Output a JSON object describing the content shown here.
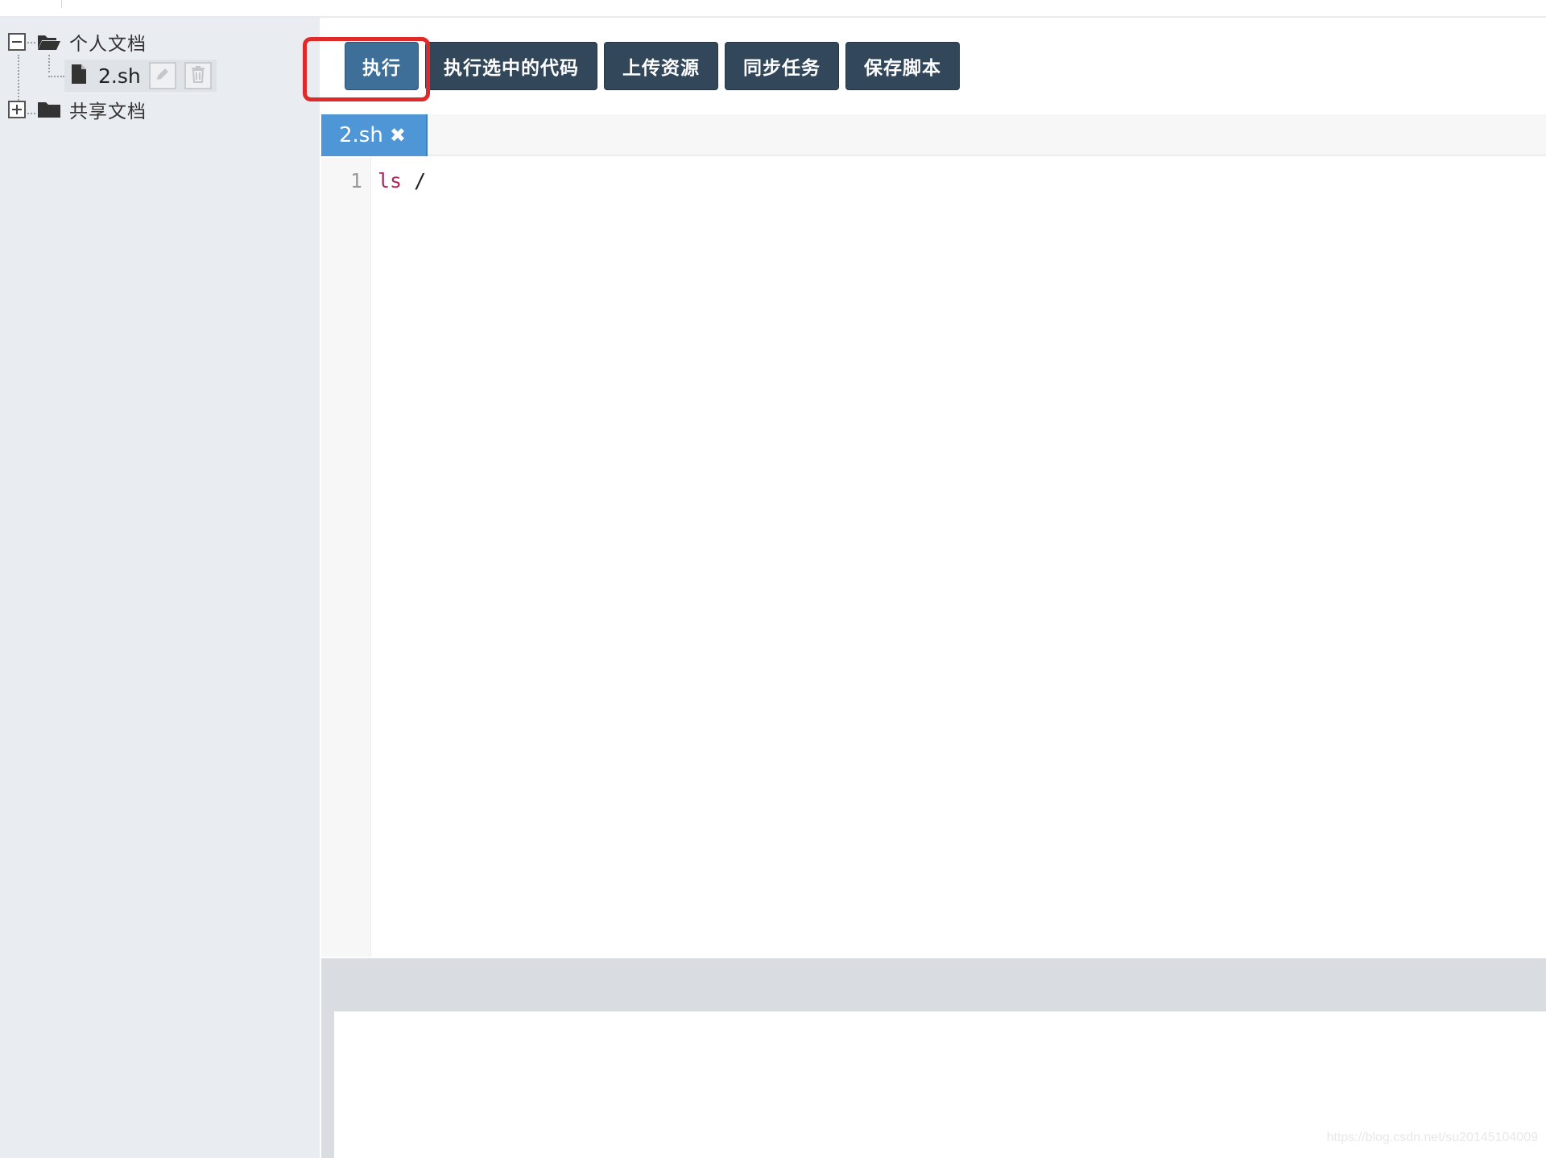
{
  "file_tree": {
    "personal_folder": {
      "label": "个人文档",
      "expanded": true,
      "files": [
        {
          "name": "2.sh"
        }
      ]
    },
    "shared_folder": {
      "label": "共享文档",
      "expanded": false
    }
  },
  "toolbar": {
    "execute_label": "执行",
    "execute_selected_label": "执行选中的代码",
    "upload_label": "上传资源",
    "sync_label": "同步任务",
    "save_label": "保存脚本"
  },
  "editor": {
    "active_tab": "2.sh",
    "lines": [
      {
        "number": "1",
        "keyword": "ls",
        "rest": " /"
      }
    ]
  },
  "watermark": "https://blog.csdn.net/su20145104009",
  "colors": {
    "toolbar_button": "#33475b",
    "primary_button": "#3e6f98",
    "tab_active": "#4f96d6",
    "highlight": "#e02a2a"
  }
}
